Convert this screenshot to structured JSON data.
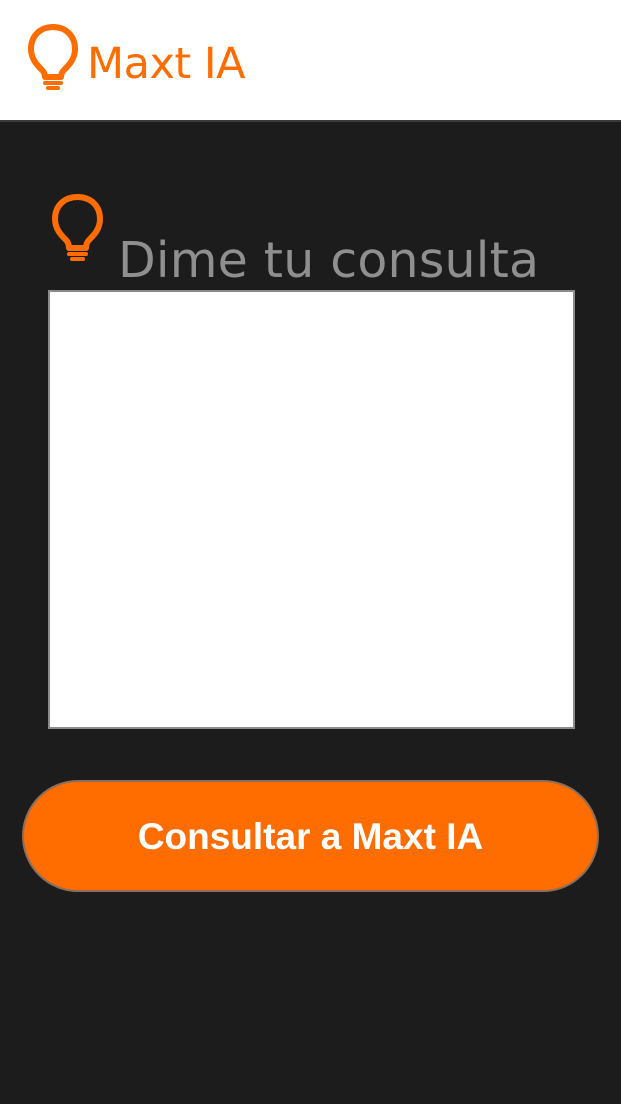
{
  "app": {
    "title": "Maxt IA",
    "brand_icon": "lightbulb-icon",
    "accent_color": "#ff6c00"
  },
  "query": {
    "heading": "Dime tu consulta",
    "heading_icon": "lightbulb-icon",
    "input_value": "",
    "input_placeholder": ""
  },
  "actions": {
    "submit_label": "Consultar a Maxt IA"
  },
  "colors": {
    "background": "#1c1c1c",
    "header_background": "#ffffff",
    "heading_text": "#8f8f8f",
    "button_text": "#ffffff"
  }
}
